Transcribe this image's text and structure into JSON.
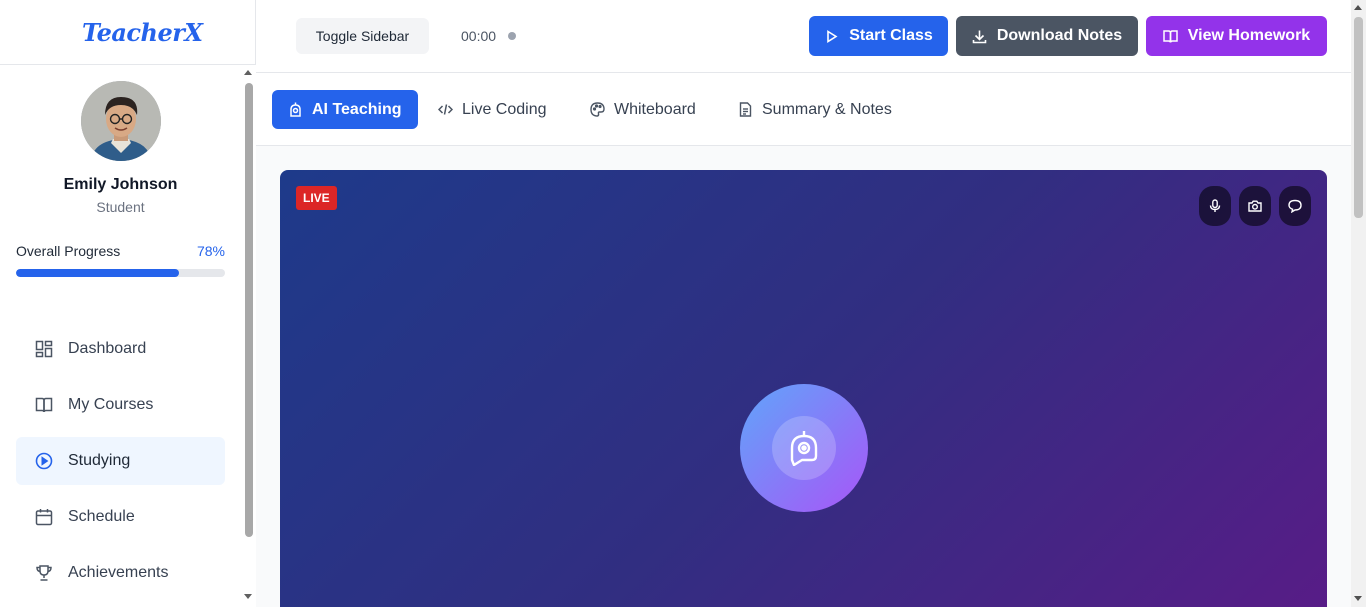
{
  "app": {
    "logo": "TeacherX"
  },
  "user": {
    "name": "Emily Johnson",
    "role": "Student"
  },
  "progress": {
    "label": "Overall Progress",
    "value_text": "78%",
    "fraction": 0.78
  },
  "sidebar": {
    "items": [
      {
        "label": "Dashboard",
        "icon": "dashboard-icon",
        "active": false
      },
      {
        "label": "My Courses",
        "icon": "book-icon",
        "active": false
      },
      {
        "label": "Studying",
        "icon": "play-circle-icon",
        "active": true
      },
      {
        "label": "Schedule",
        "icon": "calendar-icon",
        "active": false
      },
      {
        "label": "Achievements",
        "icon": "trophy-icon",
        "active": false
      }
    ]
  },
  "header": {
    "toggle_label": "Toggle Sidebar",
    "timer": "00:00",
    "start_label": "Start Class",
    "download_label": "Download Notes",
    "homework_label": "View Homework"
  },
  "tabs": [
    {
      "label": "AI Teaching",
      "icon": "bot-icon",
      "active": true
    },
    {
      "label": "Live Coding",
      "icon": "code-icon",
      "active": false
    },
    {
      "label": "Whiteboard",
      "icon": "palette-icon",
      "active": false
    },
    {
      "label": "Summary & Notes",
      "icon": "document-icon",
      "active": false
    }
  ],
  "stage": {
    "live_badge": "LIVE"
  },
  "colors": {
    "primary": "#2563eb",
    "secondary": "#4b5563",
    "accent": "#9333ea",
    "live": "#dc2626"
  }
}
